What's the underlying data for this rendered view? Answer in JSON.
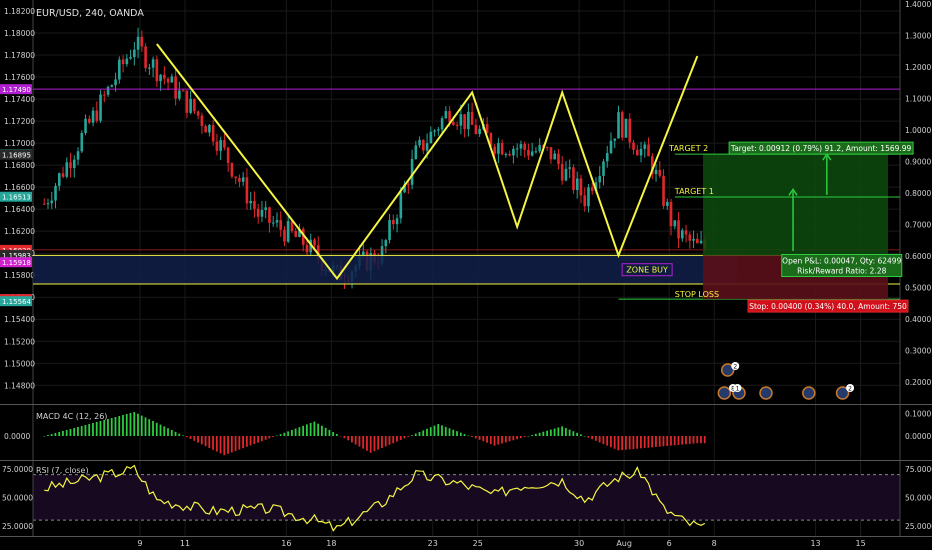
{
  "header": {
    "symbol": "EUR/USD, 240, OANDA"
  },
  "colors": {
    "bull": "#26a69a",
    "bear": "#e0282c",
    "yellow": "#f5f542",
    "green": "#2ecc40",
    "red": "#e0282c",
    "purple": "#b020d0",
    "axis_text": "#d0d0d0",
    "grid": "#1a1a1a"
  },
  "chart_data": [
    {
      "type": "candlestick",
      "name": "price",
      "ylim": [
        1.1463,
        1.183
      ],
      "y_ticks": [
        "1.18200",
        "1.18000",
        "1.17800",
        "1.17600",
        "1.17400",
        "1.17200",
        "1.17000",
        "1.16800",
        "1.16600",
        "1.16400",
        "1.16200",
        "1.16000",
        "1.15800",
        "1.15600",
        "1.15400",
        "1.15200",
        "1.15000",
        "1.14800"
      ],
      "y_ticks_values": [
        1.182,
        1.18,
        1.178,
        1.176,
        1.174,
        1.172,
        1.17,
        1.168,
        1.166,
        1.164,
        1.162,
        1.16,
        1.158,
        1.156,
        1.154,
        1.152,
        1.15,
        1.148
      ],
      "right_axis_ticks": [
        "1.4000",
        "1.3000",
        "1.2000",
        "1.1000",
        "1.0000",
        "0.9000",
        "0.8000",
        "0.7000",
        "0.6000",
        "0.5000",
        "0.4000",
        "0.3000",
        "0.2000",
        "0.1000"
      ],
      "right_axis_values": [
        1.4,
        1.3,
        1.2,
        1.1,
        1.0,
        0.9,
        0.8,
        0.7,
        0.6,
        0.5,
        0.4,
        0.3,
        0.2,
        0.1
      ],
      "x_ticks": [
        "9",
        "11",
        "16",
        "18",
        "23",
        "25",
        "30",
        "Aug",
        "6",
        "8",
        "13",
        "15"
      ],
      "x_tick_positions": [
        8.5,
        12.5,
        21.5,
        25.5,
        34.5,
        38.5,
        47.5,
        51.5,
        55.5,
        59.5,
        68.5,
        72.5
      ],
      "x_range": [
        -1,
        76
      ],
      "candles_note": "approximate OHLC read from chart",
      "price_waypoints": [
        [
          0,
          1.1645
        ],
        [
          8,
          1.179
        ],
        [
          15,
          1.171
        ],
        [
          19,
          1.1635
        ],
        [
          23,
          1.161
        ],
        [
          26,
          1.158
        ],
        [
          30,
          1.16
        ],
        [
          33,
          1.169
        ],
        [
          36,
          1.173
        ],
        [
          40,
          1.17
        ],
        [
          45,
          1.169
        ],
        [
          48,
          1.165
        ],
        [
          51,
          1.172
        ],
        [
          54,
          1.168
        ],
        [
          56,
          1.162
        ],
        [
          58,
          1.1605
        ]
      ],
      "price_labels": [
        {
          "text": "1.17490",
          "value": 1.1749,
          "color": "#b020d0"
        },
        {
          "text": "1.16898",
          "value": 1.16898,
          "color": "#26a69a"
        },
        {
          "text": "1.16895",
          "value": 1.16895,
          "color": "#2a2a2a"
        },
        {
          "text": "1.16513",
          "value": 1.16513,
          "color": "#26a69a"
        },
        {
          "text": "1.16030",
          "value": 1.1603,
          "color": "#e0282c"
        },
        {
          "text": "1.15983",
          "value": 1.15983,
          "color": "#2a2a2a"
        },
        {
          "text": "1.15918",
          "value": 1.15918,
          "color": "#d020d0"
        },
        {
          "text": "1.15583",
          "value": 1.15583,
          "color": "#e0282c"
        },
        {
          "text": "1.15564",
          "value": 1.15564,
          "color": "#26a69a"
        }
      ],
      "pattern_line": [
        [
          10,
          1.179
        ],
        [
          26,
          1.1577
        ],
        [
          38,
          1.1746
        ],
        [
          42,
          1.1624
        ],
        [
          46,
          1.1746
        ],
        [
          51,
          1.1598
        ],
        [
          58,
          1.1779
        ]
      ],
      "levels": {
        "resistance": 1.1749,
        "zone_top": 1.1598,
        "zone_bottom": 1.1572,
        "stop": 1.15583,
        "red_line": 1.1603,
        "target1": 1.1651,
        "target2": 1.169
      },
      "annotations": {
        "zone_buy": "ZONE BUY",
        "target2": "TARGET 2",
        "target1": "TARGET 1",
        "stop_loss": "STOP LOSS",
        "target_box": "Target: 0.00912 (0.79%) 91.2, Amount: 1569.99",
        "open_pnl": "Open P&L: 0.00047, Qty: 62499",
        "rr": "Risk/Reward Ratio: 2.28",
        "stop_box": "Stop: 0.00400 (0.34%) 40.0, Amount: 750"
      },
      "event_badges": [
        "2",
        "8",
        "1",
        "2"
      ]
    },
    {
      "type": "histogram",
      "name": "macd",
      "title": "MACD 4C (12, 26)",
      "y_ticks": [
        "0.0000"
      ],
      "y_ticks_right": [
        "0.0000"
      ],
      "waves": [
        [
          0,
          0.0
        ],
        [
          8,
          1.0
        ],
        [
          16,
          -0.8
        ],
        [
          24,
          0.6
        ],
        [
          29,
          -0.7
        ],
        [
          35,
          0.5
        ],
        [
          40,
          -0.4
        ],
        [
          46,
          0.4
        ],
        [
          51,
          -0.6
        ],
        [
          58,
          -0.3
        ]
      ]
    },
    {
      "type": "line",
      "name": "rsi",
      "title": "RSI (7, close)",
      "ylim": [
        16,
        82
      ],
      "y_ticks": [
        "75.0000",
        "50.0000",
        "25.0000"
      ],
      "y_ticks_values": [
        75,
        50,
        25
      ],
      "bands": [
        70,
        30
      ],
      "waypoints": [
        [
          0,
          58
        ],
        [
          8,
          75
        ],
        [
          10,
          48
        ],
        [
          15,
          38
        ],
        [
          20,
          40
        ],
        [
          24,
          30
        ],
        [
          26,
          22
        ],
        [
          30,
          45
        ],
        [
          33,
          70
        ],
        [
          37,
          62
        ],
        [
          40,
          52
        ],
        [
          42,
          60
        ],
        [
          46,
          65
        ],
        [
          48,
          48
        ],
        [
          51,
          68
        ],
        [
          53,
          72
        ],
        [
          55,
          40
        ],
        [
          57,
          28
        ],
        [
          59,
          22
        ],
        [
          60,
          17
        ]
      ]
    }
  ]
}
